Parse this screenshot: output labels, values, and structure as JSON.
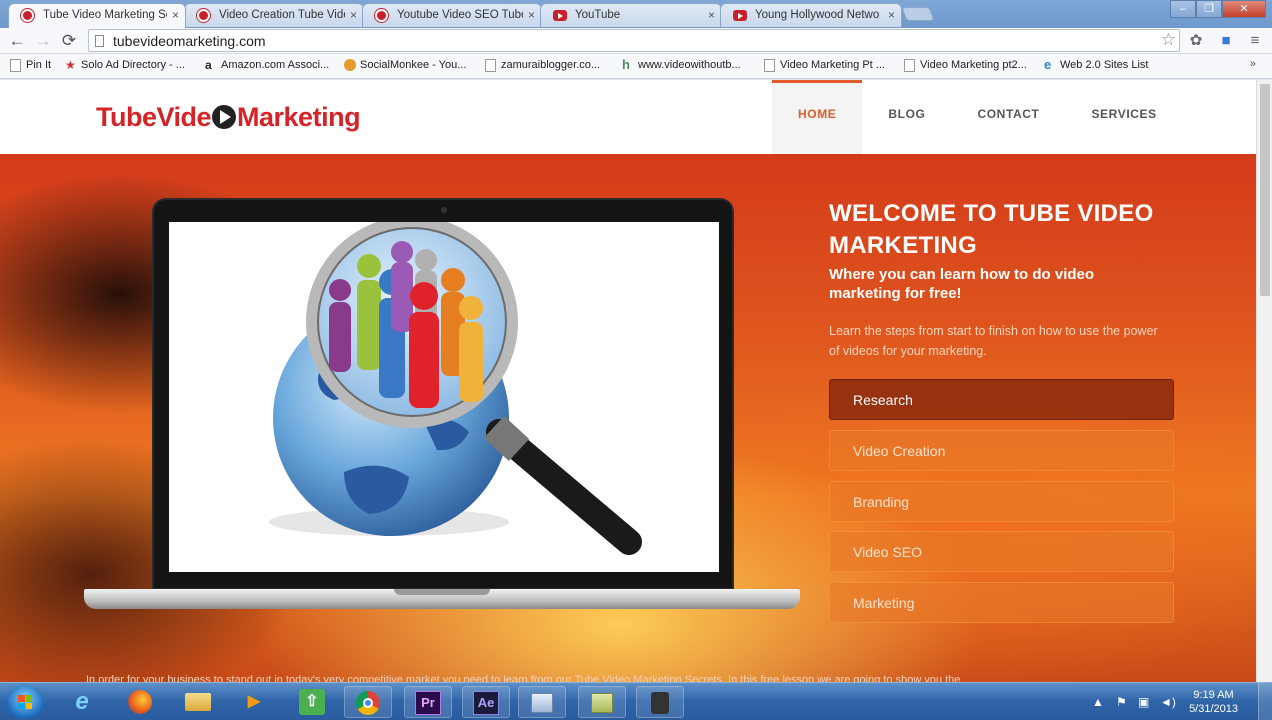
{
  "browser": {
    "tabs": [
      {
        "title": "Tube Video Marketing Sec",
        "icon": "tubevideo-favicon"
      },
      {
        "title": "Video Creation Tube Vide",
        "icon": "tubevideo-favicon"
      },
      {
        "title": "Youtube Video SEO Tube",
        "icon": "tubevideo-favicon"
      },
      {
        "title": "YouTube",
        "icon": "youtube-favicon"
      },
      {
        "title": "Young Hollywood Netwo",
        "icon": "youtube-favicon"
      }
    ],
    "tab_close": "×",
    "url": "tubevideomarketing.com",
    "back": "←",
    "forward": "→",
    "reload": "⟳",
    "star": "☆",
    "menu": "≡",
    "bookmarks": [
      {
        "label": "Pin It",
        "icon": "page"
      },
      {
        "label": "Solo Ad Directory - ...",
        "icon": "star"
      },
      {
        "label": "Amazon.com Associ...",
        "icon": "amazon"
      },
      {
        "label": "SocialMonkee - You...",
        "icon": "monkey"
      },
      {
        "label": "zamuraiblogger.co...",
        "icon": "page"
      },
      {
        "label": "www.videowithoutb...",
        "icon": "hm"
      },
      {
        "label": "Video Marketing Pt ...",
        "icon": "page"
      },
      {
        "label": "Video Marketing pt2...",
        "icon": "page"
      },
      {
        "label": "Web 2.0 Sites List",
        "icon": "ie"
      }
    ],
    "bookmarks_more": "»"
  },
  "site": {
    "logo": {
      "part1": "TubeVide",
      "part2": "Marketing"
    },
    "nav": [
      "HOME",
      "BLOG",
      "CONTACT",
      "SERVICES"
    ],
    "hero": {
      "title": "WELCOME TO TUBE VIDEO MARKETING",
      "subtitle": "Where you can learn how to do video marketing for free!",
      "description": "Learn the steps from start to finish on how to use the power of videos for your marketing.",
      "menu": [
        "Research",
        "Video Creation",
        "Branding",
        "Video SEO",
        "Marketing"
      ],
      "bottom_text": "In order for your business to stand out in today's very competitive market you need to learn from our Tube Video Marketing Secrets. In this free lesson we are going to show you the"
    }
  },
  "taskbar": {
    "apps": [
      {
        "name": "internet-explorer",
        "glyph": "e"
      },
      {
        "name": "firefox",
        "glyph": ""
      },
      {
        "name": "file-explorer",
        "glyph": ""
      },
      {
        "name": "media-player",
        "glyph": "▶"
      },
      {
        "name": "uploader",
        "glyph": "⇧"
      },
      {
        "name": "chrome",
        "glyph": ""
      },
      {
        "name": "premiere",
        "glyph": "Pr"
      },
      {
        "name": "after-effects",
        "glyph": "Ae"
      },
      {
        "name": "app-9",
        "glyph": ""
      },
      {
        "name": "app-10",
        "glyph": ""
      },
      {
        "name": "camtasia",
        "glyph": ""
      }
    ],
    "time": "9:19 AM",
    "date": "5/31/2013"
  },
  "colors": {
    "brand_red": "#d52427",
    "nav_active": "#e05a2a",
    "hero_orange": "#ee7a22"
  }
}
